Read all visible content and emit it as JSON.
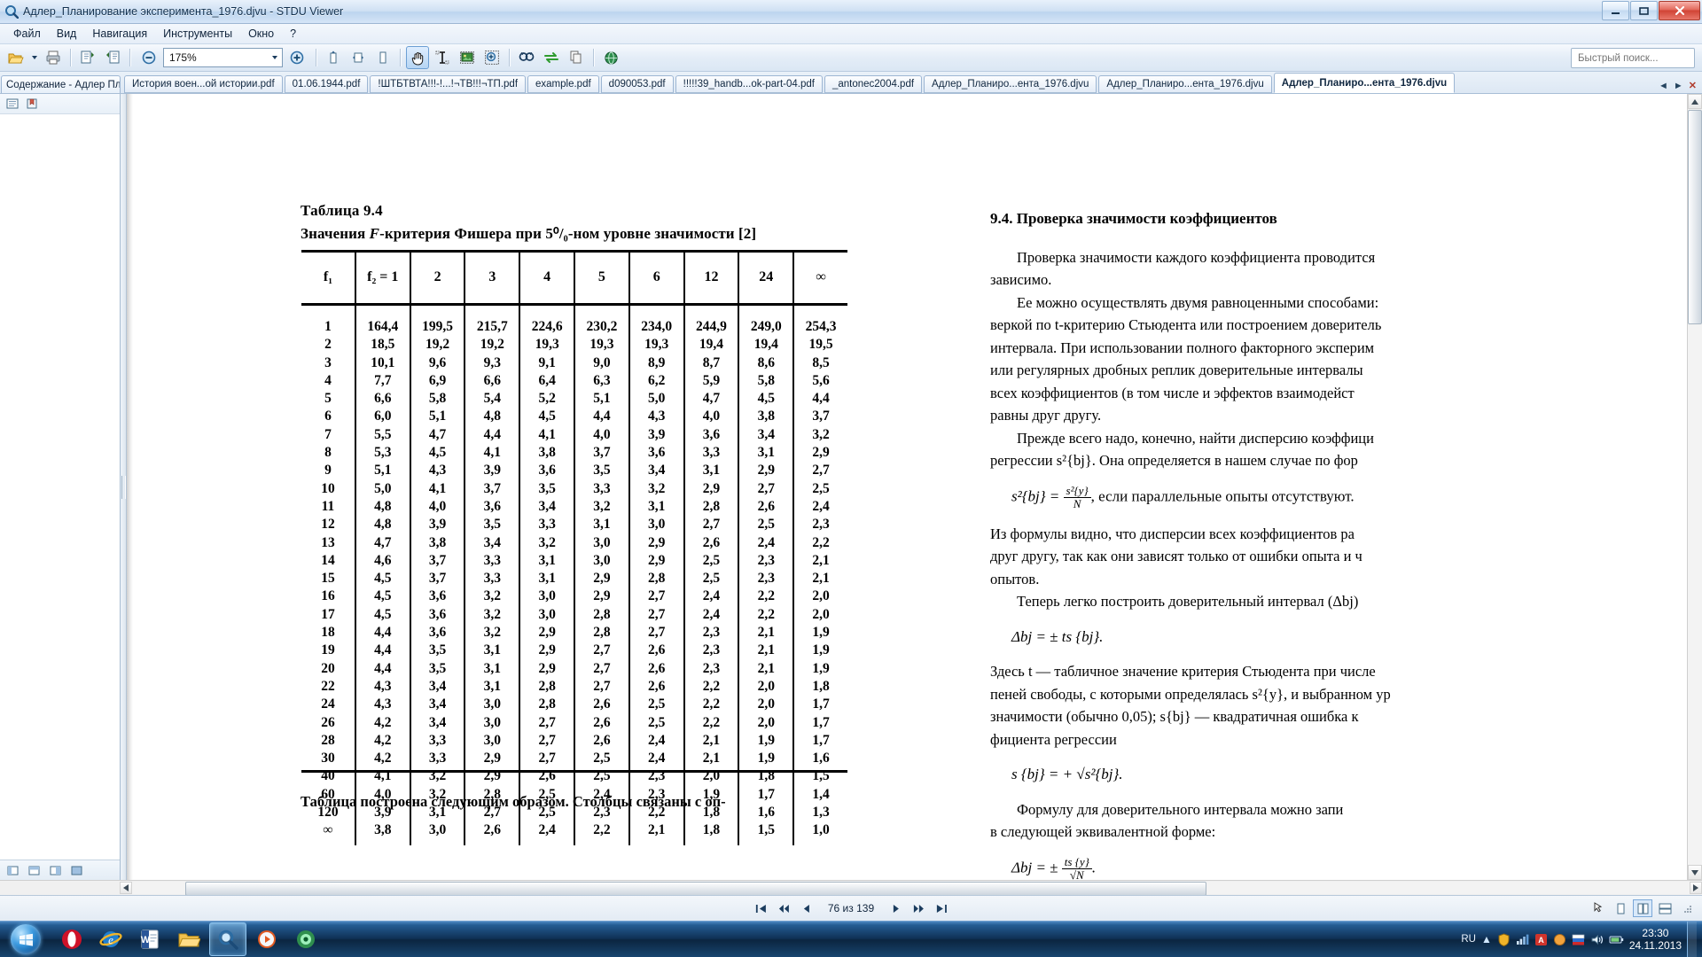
{
  "window": {
    "title": "Адлер_Планирование эксперимента_1976.djvu - STDU Viewer",
    "minimize_label": "—",
    "maximize_label": "❐",
    "close_label": "✕"
  },
  "menu": {
    "items": [
      {
        "label": "Файл",
        "name": "menu-file"
      },
      {
        "label": "Вид",
        "name": "menu-view"
      },
      {
        "label": "Навигация",
        "name": "menu-navigation"
      },
      {
        "label": "Инструменты",
        "name": "menu-tools"
      },
      {
        "label": "Окно",
        "name": "menu-window"
      },
      {
        "label": "?",
        "name": "menu-help"
      }
    ]
  },
  "toolbar": {
    "zoom_value": "175%",
    "zoom_out_title": "Уменьшить",
    "zoom_in_title": "Увеличить",
    "buttons": [
      {
        "name": "open-file-icon",
        "title": "Открыть"
      },
      {
        "name": "print-icon",
        "title": "Печать"
      },
      {
        "name": "single-page-icon",
        "title": "Одна страница"
      },
      {
        "name": "facing-pages-icon",
        "title": "Две страницы"
      },
      {
        "name": "rotate-left-icon",
        "title": "Повернуть влево"
      },
      {
        "name": "rotate-right-icon",
        "title": "Повернуть вправо"
      },
      {
        "name": "fit-page-icon",
        "title": "По странице"
      },
      {
        "name": "hand-tool-icon",
        "title": "Рука"
      },
      {
        "name": "text-select-icon",
        "title": "Выделение текста"
      },
      {
        "name": "image-select-icon",
        "title": "Выделение изображения"
      },
      {
        "name": "zoom-select-icon",
        "title": "Увеличение области"
      },
      {
        "name": "find-icon",
        "title": "Поиск"
      },
      {
        "name": "compare-icon",
        "title": "Сравнить"
      },
      {
        "name": "copy-icon",
        "title": "Копировать"
      },
      {
        "name": "globe-icon",
        "title": "Веб"
      }
    ],
    "search_placeholder": "Быстрый поиск..."
  },
  "sidepanel": {
    "tab_label": "Содержание - Адлер План",
    "buttons": [
      {
        "name": "contents-icon"
      },
      {
        "name": "bookmarks-icon"
      },
      {
        "name": "thumbnails-icon"
      }
    ],
    "bottom_buttons": [
      {
        "name": "panel-layout-icon-1"
      },
      {
        "name": "panel-layout-icon-2"
      },
      {
        "name": "panel-layout-icon-3"
      },
      {
        "name": "panel-layout-icon-4"
      }
    ]
  },
  "document_tabs": {
    "items": [
      {
        "label": "История воен...ой истории.pdf",
        "selected": false
      },
      {
        "label": "01.06.1944.pdf",
        "selected": false
      },
      {
        "label": "!ШТБТВТА!!!-!...!¬ТВ!!!¬ТП.pdf",
        "selected": false
      },
      {
        "label": "example.pdf",
        "selected": false
      },
      {
        "label": "d090053.pdf",
        "selected": false
      },
      {
        "label": "!!!!!39_handb...ok-part-04.pdf",
        "selected": false
      },
      {
        "label": "_antonec2004.pdf",
        "selected": false
      },
      {
        "label": "Адлер_Планиро...ента_1976.djvu",
        "selected": false
      },
      {
        "label": "Адлер_Планиро...ента_1976.djvu",
        "selected": false
      },
      {
        "label": "Адлер_Планиро...ента_1976.djvu",
        "selected": true
      }
    ],
    "prev_label": "◄",
    "next_label": "►",
    "close_label": "✕"
  },
  "statusbar": {
    "page_info": "76 из 139",
    "first_label": "|◄",
    "prev_label": "◄◄",
    "back_label": "◄",
    "fwd_label": "►",
    "next_label": "►►",
    "last_label": "►|",
    "view_icons": [
      {
        "name": "view-mode-single-icon",
        "selected": false
      },
      {
        "name": "view-mode-continuous-icon",
        "selected": true
      },
      {
        "name": "view-mode-facing-icon",
        "selected": false
      }
    ]
  },
  "taskbar": {
    "start_label": "",
    "apps": [
      {
        "name": "taskbar-opera-icon"
      },
      {
        "name": "taskbar-ie-icon"
      },
      {
        "name": "taskbar-word-icon"
      },
      {
        "name": "taskbar-explorer-icon"
      },
      {
        "name": "taskbar-stdu-icon"
      },
      {
        "name": "taskbar-media-icon"
      },
      {
        "name": "taskbar-record-icon"
      }
    ],
    "language": "RU",
    "clock_time": "23:30",
    "clock_date": "24.11.2013"
  },
  "page_content": {
    "table_number": "Таблица 9.4",
    "table_title_parts": {
      "before": "Значения ",
      "italic": "F",
      "after": "-критерия  Фишера  при  5⁰/₀-ном  уровне  значимости  [2]"
    },
    "table": {
      "corner_label": "f₁",
      "headers": [
        "f₂ = 1",
        "2",
        "3",
        "4",
        "5",
        "6",
        "12",
        "24",
        "∞"
      ],
      "rows": [
        {
          "f1": "1",
          "values": [
            "164,4",
            "199,5",
            "215,7",
            "224,6",
            "230,2",
            "234,0",
            "244,9",
            "249,0",
            "254,3"
          ]
        },
        {
          "f1": "2",
          "values": [
            "18,5",
            "19,2",
            "19,2",
            "19,3",
            "19,3",
            "19,3",
            "19,4",
            "19,4",
            "19,5"
          ]
        },
        {
          "f1": "3",
          "values": [
            "10,1",
            "9,6",
            "9,3",
            "9,1",
            "9,0",
            "8,9",
            "8,7",
            "8,6",
            "8,5"
          ]
        },
        {
          "f1": "4",
          "values": [
            "7,7",
            "6,9",
            "6,6",
            "6,4",
            "6,3",
            "6,2",
            "5,9",
            "5,8",
            "5,6"
          ]
        },
        {
          "f1": "5",
          "values": [
            "6,6",
            "5,8",
            "5,4",
            "5,2",
            "5,1",
            "5,0",
            "4,7",
            "4,5",
            "4,4"
          ]
        },
        {
          "f1": "6",
          "values": [
            "6,0",
            "5,1",
            "4,8",
            "4,5",
            "4,4",
            "4,3",
            "4,0",
            "3,8",
            "3,7"
          ]
        },
        {
          "f1": "7",
          "values": [
            "5,5",
            "4,7",
            "4,4",
            "4,1",
            "4,0",
            "3,9",
            "3,6",
            "3,4",
            "3,2"
          ]
        },
        {
          "f1": "8",
          "values": [
            "5,3",
            "4,5",
            "4,1",
            "3,8",
            "3,7",
            "3,6",
            "3,3",
            "3,1",
            "2,9"
          ]
        },
        {
          "f1": "9",
          "values": [
            "5,1",
            "4,3",
            "3,9",
            "3,6",
            "3,5",
            "3,4",
            "3,1",
            "2,9",
            "2,7"
          ]
        },
        {
          "f1": "10",
          "values": [
            "5,0",
            "4,1",
            "3,7",
            "3,5",
            "3,3",
            "3,2",
            "2,9",
            "2,7",
            "2,5"
          ]
        },
        {
          "f1": "11",
          "values": [
            "4,8",
            "4,0",
            "3,6",
            "3,4",
            "3,2",
            "3,1",
            "2,8",
            "2,6",
            "2,4"
          ]
        },
        {
          "f1": "12",
          "values": [
            "4,8",
            "3,9",
            "3,5",
            "3,3",
            "3,1",
            "3,0",
            "2,7",
            "2,5",
            "2,3"
          ]
        },
        {
          "f1": "13",
          "values": [
            "4,7",
            "3,8",
            "3,4",
            "3,2",
            "3,0",
            "2,9",
            "2,6",
            "2,4",
            "2,2"
          ]
        },
        {
          "f1": "14",
          "values": [
            "4,6",
            "3,7",
            "3,3",
            "3,1",
            "3,0",
            "2,9",
            "2,5",
            "2,3",
            "2,1"
          ]
        },
        {
          "f1": "15",
          "values": [
            "4,5",
            "3,7",
            "3,3",
            "3,1",
            "2,9",
            "2,8",
            "2,5",
            "2,3",
            "2,1"
          ]
        },
        {
          "f1": "16",
          "values": [
            "4,5",
            "3,6",
            "3,2",
            "3,0",
            "2,9",
            "2,7",
            "2,4",
            "2,2",
            "2,0"
          ]
        },
        {
          "f1": "17",
          "values": [
            "4,5",
            "3,6",
            "3,2",
            "3,0",
            "2,8",
            "2,7",
            "2,4",
            "2,2",
            "2,0"
          ]
        },
        {
          "f1": "18",
          "values": [
            "4,4",
            "3,6",
            "3,2",
            "2,9",
            "2,8",
            "2,7",
            "2,3",
            "2,1",
            "1,9"
          ]
        },
        {
          "f1": "19",
          "values": [
            "4,4",
            "3,5",
            "3,1",
            "2,9",
            "2,7",
            "2,6",
            "2,3",
            "2,1",
            "1,9"
          ]
        },
        {
          "f1": "20",
          "values": [
            "4,4",
            "3,5",
            "3,1",
            "2,9",
            "2,7",
            "2,6",
            "2,3",
            "2,1",
            "1,9"
          ]
        },
        {
          "f1": "22",
          "values": [
            "4,3",
            "3,4",
            "3,1",
            "2,8",
            "2,7",
            "2,6",
            "2,2",
            "2,0",
            "1,8"
          ]
        },
        {
          "f1": "24",
          "values": [
            "4,3",
            "3,4",
            "3,0",
            "2,8",
            "2,6",
            "2,5",
            "2,2",
            "2,0",
            "1,7"
          ]
        },
        {
          "f1": "26",
          "values": [
            "4,2",
            "3,4",
            "3,0",
            "2,7",
            "2,6",
            "2,5",
            "2,2",
            "2,0",
            "1,7"
          ]
        },
        {
          "f1": "28",
          "values": [
            "4,2",
            "3,3",
            "3,0",
            "2,7",
            "2,6",
            "2,4",
            "2,1",
            "1,9",
            "1,7"
          ]
        },
        {
          "f1": "30",
          "values": [
            "4,2",
            "3,3",
            "2,9",
            "2,7",
            "2,5",
            "2,4",
            "2,1",
            "1,9",
            "1,6"
          ]
        },
        {
          "f1": "40",
          "values": [
            "4,1",
            "3,2",
            "2,9",
            "2,6",
            "2,5",
            "2,3",
            "2,0",
            "1,8",
            "1,5"
          ]
        },
        {
          "f1": "60",
          "values": [
            "4,0",
            "3,2",
            "2,8",
            "2,5",
            "2,4",
            "2,3",
            "1,9",
            "1,7",
            "1,4"
          ]
        },
        {
          "f1": "120",
          "values": [
            "3,9",
            "3,1",
            "2,7",
            "2,5",
            "2,3",
            "2,2",
            "1,8",
            "1,6",
            "1,3"
          ]
        },
        {
          "f1": "∞",
          "values": [
            "3,8",
            "3,0",
            "2,6",
            "2,4",
            "2,2",
            "2,1",
            "1,8",
            "1,5",
            "1,0"
          ]
        }
      ]
    },
    "after_table_text": "Таблица построена следующим образом. Столбцы связаны с оп-",
    "right_column": {
      "heading": "9.4. Проверка значимости коэффициентов",
      "para1": "Проверка значимости каждого коэффициента проводится",
      "para1b": "зависимо.",
      "para2": "Ее можно осуществлять двумя равноценными способами:",
      "para2b": "веркой по t-критерию Стьюдента или построением доверитель",
      "para2c": "интервала. При использовании полного факторного эксперим",
      "para2d": "или регулярных дробных реплик доверительные интервалы",
      "para2e": "всех коэффициентов (в том числе и эффектов взаимодейст",
      "para2f": "равны друг другу.",
      "para3": "Прежде всего надо, конечно, найти дисперсию коэффици",
      "para3b": "регрессии s²{bj}. Она определяется в нашем случае по фор",
      "formula1_left": "s²{bj} = ",
      "formula1_num": "s²{y}",
      "formula1_den": "N",
      "formula1_tail": ", если параллельные опыты отсутствуют.",
      "para4": "Из формулы видно, что дисперсии всех коэффициентов ра",
      "para4b": "друг другу, так как они зависят только от ошибки опыта и ч",
      "para4c": "опытов.",
      "para5": "Теперь легко построить доверительный интервал (Δbj)",
      "formula2": "Δbj = ± ts {bj}.",
      "para6": "Здесь t — табличное значение критерия Стьюдента при числе",
      "para6b": "пеней свободы, с которыми определялась s²{y}, и выбранном ур",
      "para6c": "значимости (обычно 0,05); s{bj} — квадратичная ошибка к",
      "para6d": "фициента регрессии",
      "formula3": "s {bj} = + √s²{bj}.",
      "para7": "Формулу для доверительного интервала можно запи",
      "para7b": "в следующей эквивалентной форме:",
      "formula4_left": "Δbj = ± ",
      "formula4_num": "ts {y}",
      "formula4_den": "√N",
      "formula4_tail": "."
    }
  }
}
